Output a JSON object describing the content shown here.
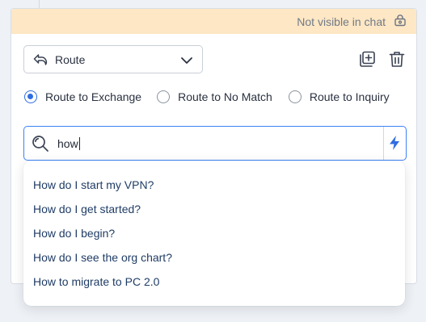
{
  "banner": {
    "text": "Not visible in chat",
    "icon": "lock-eye-icon"
  },
  "route_select": {
    "icon": "route-arrow-icon",
    "value": "Route"
  },
  "actions": {
    "duplicate_icon": "copy-plus-icon",
    "delete_icon": "trash-icon"
  },
  "radios": [
    {
      "label": "Route to Exchange",
      "checked": true
    },
    {
      "label": "Route to No Match",
      "checked": false
    },
    {
      "label": "Route to Inquiry",
      "checked": false
    }
  ],
  "search": {
    "value": "how",
    "icon": "search-icon",
    "action_icon": "lightning-icon"
  },
  "suggestions": [
    "How do I start my VPN?",
    "How do I get started?",
    "How do I begin?",
    "How do I see the org chart?",
    "How to migrate to PC 2.0"
  ],
  "colors": {
    "accent": "#2f6de1",
    "banner_bg": "#fde7c4",
    "link": "#1f3c66"
  }
}
